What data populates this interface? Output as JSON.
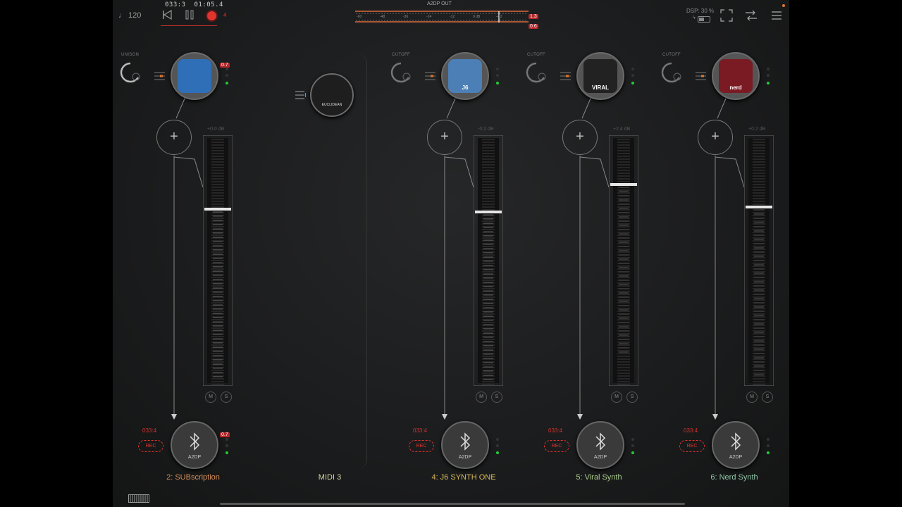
{
  "transport": {
    "tempo": "♩ 120",
    "position": "033:3",
    "time": "01:05.4",
    "rec_count": "4"
  },
  "master": {
    "label": "A2DP OUT",
    "scale": [
      "-60",
      "-48",
      "-36",
      "-24",
      "-12",
      "0 dB",
      "+12"
    ],
    "peak_l": "1.3",
    "peak_r": "0.6"
  },
  "status": {
    "dsp": "DSP: 30 %"
  },
  "midi": {
    "plugin_label": "EUCLIDEAN",
    "name": "MIDI 3"
  },
  "channels": [
    {
      "knob_label": "UNISON",
      "plugin_label": "",
      "peak": "0.7",
      "db": "+0.0 dB",
      "level": 0.29,
      "pos": "033:4",
      "rec": "REC",
      "out_peak": "0.7",
      "out_label": "A2DP",
      "name": "2: SUBscription",
      "color": "#d38b57",
      "plugin_bg": "#2f6fb8"
    },
    {
      "knob_label": "CUTOFF",
      "plugin_label": "J6",
      "peak": "",
      "db": "-0.2 dB",
      "level": 0.3,
      "pos": "033:4",
      "rec": "REC",
      "out_peak": "",
      "out_label": "A2DP",
      "name": "4: J6 SYNTH ONE",
      "color": "#d6b85a",
      "plugin_bg": "#4b7fb5"
    },
    {
      "knob_label": "CUTOFF",
      "plugin_label": "VIRAL",
      "peak": "",
      "db": "+2.4 dB",
      "level": 0.19,
      "pos": "033:4",
      "rec": "REC",
      "out_peak": "",
      "out_label": "A2DP",
      "name": "5: Viral Synth",
      "color": "#a8c98a",
      "plugin_bg": "#222"
    },
    {
      "knob_label": "CUTOFF",
      "plugin_label": "nerd",
      "peak": "",
      "db": "+0.2 dB",
      "level": 0.28,
      "pos": "033:4",
      "rec": "REC",
      "out_peak": "",
      "out_label": "A2DP",
      "name": "6: Nerd Synth",
      "color": "#8fc5a8",
      "plugin_bg": "#7a1a22"
    }
  ],
  "ms": {
    "mute": "M",
    "solo": "S"
  }
}
